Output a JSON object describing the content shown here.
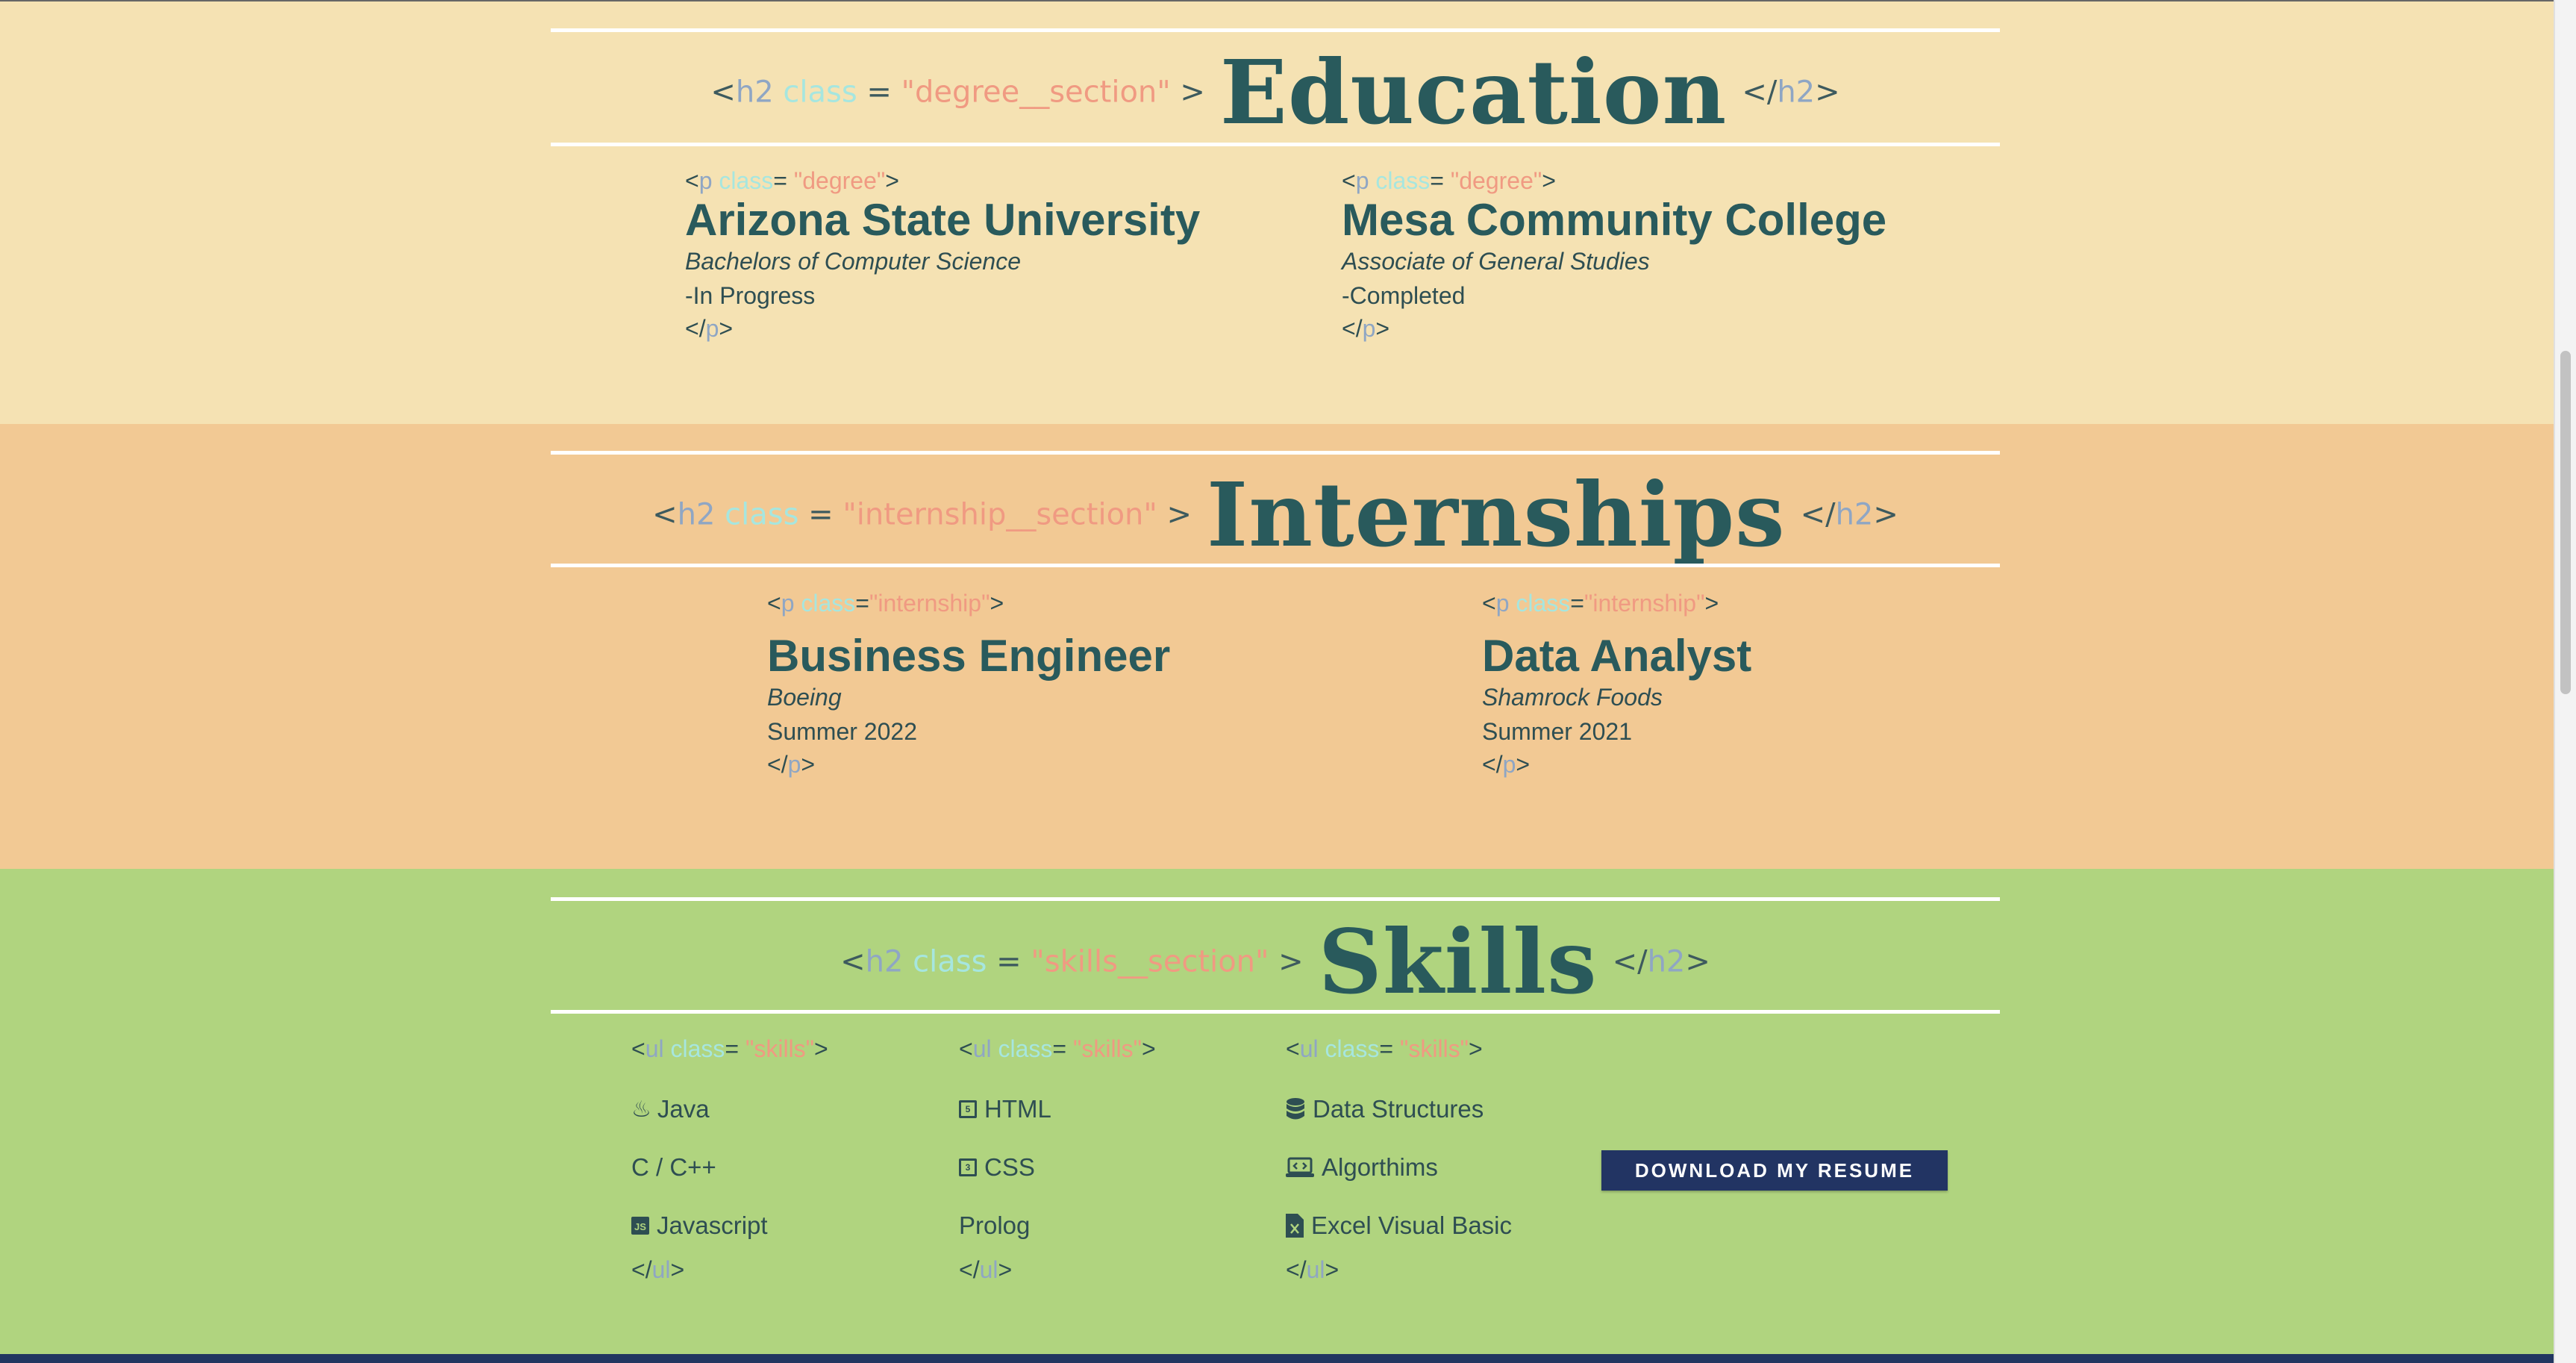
{
  "education": {
    "heading": {
      "open": "<",
      "tag": "h2",
      "attr": "class",
      "eq": "=",
      "value": "\"degree__section\"",
      "gt": ">",
      "title": "Education",
      "close_open": "</",
      "close_tag": "h2",
      "close_gt": ">"
    },
    "items": [
      {
        "tag_open": "<",
        "tag": "p",
        "attr": "class",
        "eq": "=",
        "value": "\"degree\"",
        "gt": ">",
        "name": "Arizona State University",
        "degree": "Bachelors of Computer Science",
        "status": "-In Progress",
        "close_open": "</",
        "close_tag": "p",
        "close_gt": ">"
      },
      {
        "tag_open": "<",
        "tag": "p",
        "attr": "class",
        "eq": "=",
        "value": "\"degree\"",
        "gt": ">",
        "name": "Mesa Community College",
        "degree": "Associate of General Studies",
        "status": "-Completed",
        "close_open": "</",
        "close_tag": "p",
        "close_gt": ">"
      }
    ]
  },
  "internships": {
    "heading": {
      "open": "<",
      "tag": "h2",
      "attr": "class",
      "eq": "=",
      "value": "\"internship__section\"",
      "gt": ">",
      "title": "Internships",
      "close_open": "</",
      "close_tag": "h2",
      "close_gt": ">"
    },
    "items": [
      {
        "tag_open": "<",
        "tag": "p",
        "attr": "class",
        "eq": "=",
        "value": "\"internship\"",
        "gt": ">",
        "title": "Business Engineer",
        "company": "Boeing",
        "date": "Summer 2022",
        "close_open": "</",
        "close_tag": "p",
        "close_gt": ">"
      },
      {
        "tag_open": "<",
        "tag": "p",
        "attr": "class",
        "eq": "=",
        "value": "\"internship\"",
        "gt": ">",
        "title": "Data Analyst",
        "company": "Shamrock Foods",
        "date": "Summer 2021",
        "close_open": "</",
        "close_tag": "p",
        "close_gt": ">"
      }
    ]
  },
  "skills": {
    "heading": {
      "open": "<",
      "tag": "h2",
      "attr": "class",
      "eq": "=",
      "value": "\"skills__section\"",
      "gt": ">",
      "title": "Skills",
      "close_open": "</",
      "close_tag": "h2",
      "close_gt": ">"
    },
    "list_tag": {
      "open": "<",
      "tag": "ul",
      "attr": "class",
      "eq": "=",
      "value": "\"skills\"",
      "gt": ">",
      "close_open": "</",
      "close_tag": "ul",
      "close_gt": ">"
    },
    "columns": [
      [
        {
          "icon": "java-icon",
          "label": "Java"
        },
        {
          "icon": "c-cpp-icon",
          "label": "C / C++"
        },
        {
          "icon": "js-icon",
          "label": "Javascript"
        }
      ],
      [
        {
          "icon": "html5-icon",
          "label": "HTML"
        },
        {
          "icon": "css3-icon",
          "label": "CSS"
        },
        {
          "icon": "none",
          "label": "Prolog"
        }
      ],
      [
        {
          "icon": "database-icon",
          "label": "Data Structures"
        },
        {
          "icon": "laptop-code-icon",
          "label": "Algorthims"
        },
        {
          "icon": "excel-icon",
          "label": "Excel Visual Basic"
        }
      ]
    ],
    "resume_button": "DOWNLOAD MY RESUME"
  },
  "colors": {
    "education_bg": "#f5e2b3",
    "internship_bg": "#f2c994",
    "skills_bg": "#b0d47f",
    "heading_text": "#295a5c",
    "button_bg": "#223463",
    "footer_bg": "#213660"
  }
}
